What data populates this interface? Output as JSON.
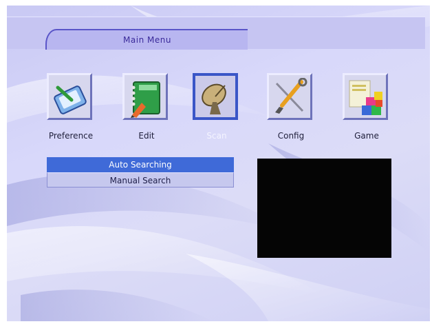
{
  "header": {
    "title": "Main  Menu"
  },
  "icons": [
    {
      "label": "Preference",
      "icon": "preference-icon",
      "selected": false
    },
    {
      "label": "Edit",
      "icon": "edit-notebook-icon",
      "selected": false
    },
    {
      "label": "Scan",
      "icon": "satellite-dish-icon",
      "selected": true
    },
    {
      "label": "Config",
      "icon": "tools-icon",
      "selected": false
    },
    {
      "label": "Game",
      "icon": "game-blocks-icon",
      "selected": false
    }
  ],
  "submenu": [
    {
      "label": "Auto Searching",
      "active": true
    },
    {
      "label": "Manual Search",
      "active": false
    }
  ],
  "colors": {
    "selection": "#3f6ad8",
    "background": "#d8d8fa",
    "preview": "#050505"
  }
}
